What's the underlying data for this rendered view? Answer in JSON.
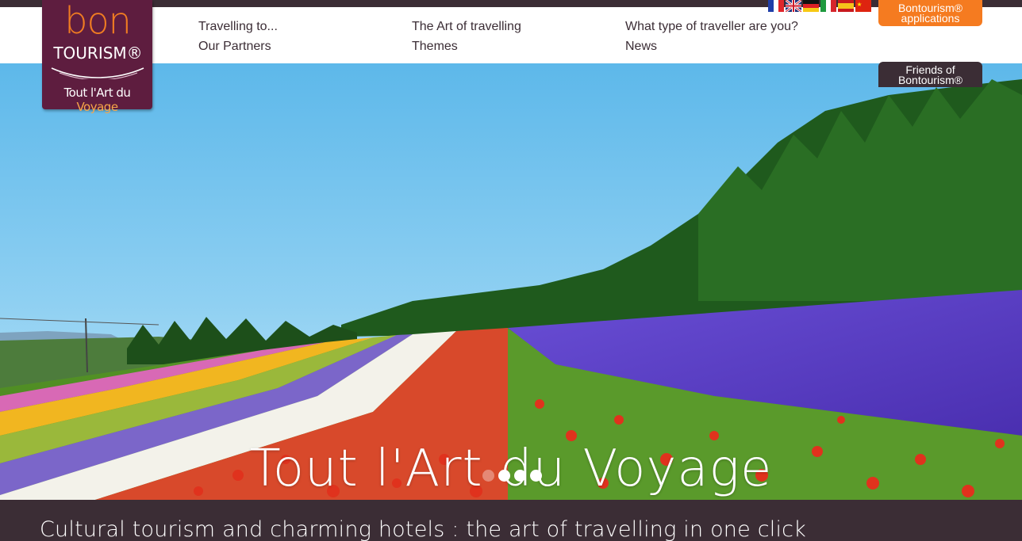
{
  "brand": {
    "logo_top": "bon",
    "logo_name": "TOURISM®",
    "logo_tagline_a": "Tout l'Art du ",
    "logo_tagline_b": "Voyage",
    "colors": {
      "plum": "#5e1d3f",
      "orange": "#f57b20",
      "dark": "#3b2d35"
    }
  },
  "nav": {
    "travelling_to": "Travelling to...",
    "art_of_travelling": "The Art of travelling",
    "traveller_type": "What type of traveller are you?",
    "partners": "Our Partners",
    "themes": "Themes",
    "news": "News"
  },
  "languages": [
    {
      "icon": "flag-fr-icon"
    },
    {
      "icon": "flag-uk-icon"
    },
    {
      "icon": "flag-de-icon"
    },
    {
      "icon": "flag-it-icon"
    },
    {
      "icon": "flag-es-icon"
    },
    {
      "icon": "flag-cn-icon"
    }
  ],
  "buttons": {
    "apps_line1": "Bontourism®",
    "apps_line2": "applications",
    "friends_line1": "Friends of",
    "friends_line2": "Bontourism®"
  },
  "hero": {
    "title": "Tout l'Art du Voyage",
    "slides": 4,
    "active_slide": 1
  },
  "footer": {
    "tagline": "Cultural tourism and charming hotels : the art of travelling in one click"
  }
}
